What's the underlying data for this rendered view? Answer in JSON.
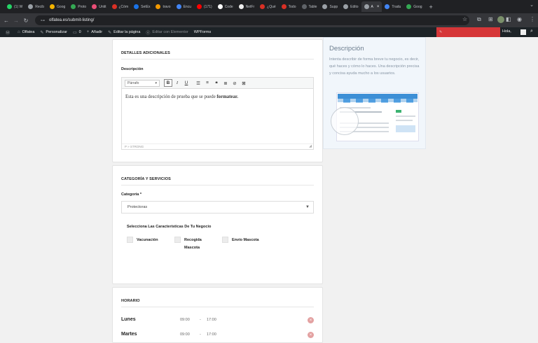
{
  "browser": {
    "tabs": [
      {
        "label": "(1) W",
        "color": "#25d366"
      },
      {
        "label": "Recib",
        "color": "#9aa0a6"
      },
      {
        "label": "Goog",
        "color": "#f4b400"
      },
      {
        "label": "Proto",
        "color": "#34a853"
      },
      {
        "label": "Untit",
        "color": "#e94e77"
      },
      {
        "label": "¿Cóm",
        "color": "#d93025"
      },
      {
        "label": "SetEx",
        "color": "#1a73e8"
      },
      {
        "label": "travo",
        "color": "#f29900"
      },
      {
        "label": "Encu",
        "color": "#4285f4"
      },
      {
        "label": "(171)",
        "color": "#ff0000"
      },
      {
        "label": "Code",
        "color": "#ffffff"
      },
      {
        "label": "NetFr",
        "color": "#eeeeee"
      },
      {
        "label": "¿Qué",
        "color": "#d93025"
      },
      {
        "label": "Todo",
        "color": "#d93025"
      },
      {
        "label": "Table",
        "color": "#5f6368"
      },
      {
        "label": "Supp",
        "color": "#9aa0a6"
      },
      {
        "label": "Edito",
        "color": "#9aa0a6"
      },
      {
        "label": "A",
        "color": "#9aa0a6",
        "active": true
      },
      {
        "label": "Tradu",
        "color": "#4285f4"
      },
      {
        "label": "Goog",
        "color": "#34a853"
      }
    ],
    "url": "olfatea.es/submit-listing/"
  },
  "wp_admin_bar": {
    "site_name": "Olfatea",
    "customize": "Personalizar",
    "comments": "0",
    "add_new": "Añadir",
    "edit_page": "Editar la página",
    "elementor": "Editar con Elementor",
    "wpforms": "WPForms",
    "greeting": "Hola,"
  },
  "details_card": {
    "title": "DETALLES ADICIONALES",
    "description_label": "Descripción",
    "format_select": "Párrafo",
    "editor_text_plain": "Esta es una descripción de prueba que se puede ",
    "editor_text_bold": "formatear.",
    "status_path": "P » STRONG"
  },
  "category_card": {
    "title": "CATEGORÍA Y SERVICIOS",
    "category_label": "Categoría *",
    "category_value": "Protectoras",
    "features_heading": "Selecciona Las Características De Tu Negocio",
    "features": [
      "Vacunación",
      "Recogida Mascota",
      "Envío Mascota"
    ]
  },
  "hours_card": {
    "title": "HORARIO",
    "rows": [
      {
        "day": "Lunes",
        "open": "09:00",
        "sep": "-",
        "close": "17:00"
      },
      {
        "day": "Martes",
        "open": "09:00",
        "sep": "-",
        "close": "17:00"
      }
    ]
  },
  "help_panel": {
    "title": "Descripción",
    "text": "Intenta describir de forma breve tu negocio, es decir, qué haces y cómo lo haces. Una descripción precisa y concisa ayuda mucho a los usuarios."
  },
  "icons": [
    "whatsapp-icon",
    "back-icon",
    "forward-icon",
    "reload-icon",
    "star-icon",
    "extensions-icon",
    "wordpress-icon",
    "bold-icon",
    "italic-icon",
    "underline-icon",
    "bullet-list-icon",
    "numbered-list-icon",
    "quote-icon",
    "align-icon",
    "link-icon",
    "unlink-icon",
    "remove-icon",
    "search-icon"
  ]
}
